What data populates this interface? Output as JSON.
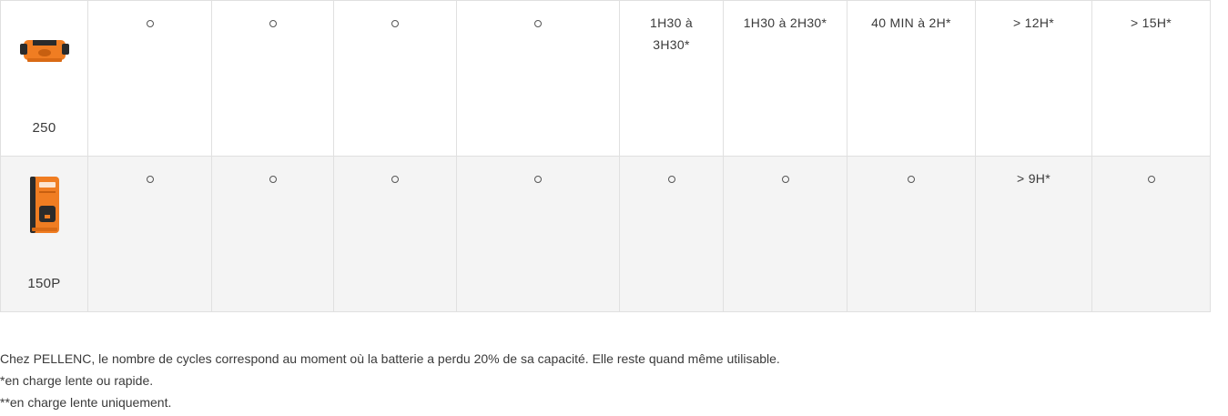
{
  "rows": [
    {
      "product": "250",
      "product_icon": "battery-250-icon",
      "cells": [
        "○",
        "○",
        "○",
        "○",
        "1H30 à 3H30*",
        "1H30 à 2H30*",
        "40 MIN à 2H*",
        "> 12H*",
        "> 15H*"
      ]
    },
    {
      "product": "150P",
      "product_icon": "battery-150p-icon",
      "cells": [
        "○",
        "○",
        "○",
        "○",
        "○",
        "○",
        "○",
        "> 9H*",
        "○"
      ]
    }
  ],
  "notes": {
    "line1": "Chez PELLENC, le nombre de cycles correspond au moment où la batterie a perdu 20% de sa capacité. Elle reste quand même utilisable.",
    "line2": "*en charge lente ou rapide.",
    "line3": "**en charge lente uniquement."
  },
  "colors": {
    "brand_orange": "#f07d22",
    "row_alt_bg": "#f4f4f4",
    "border": "#e0e0e0"
  }
}
